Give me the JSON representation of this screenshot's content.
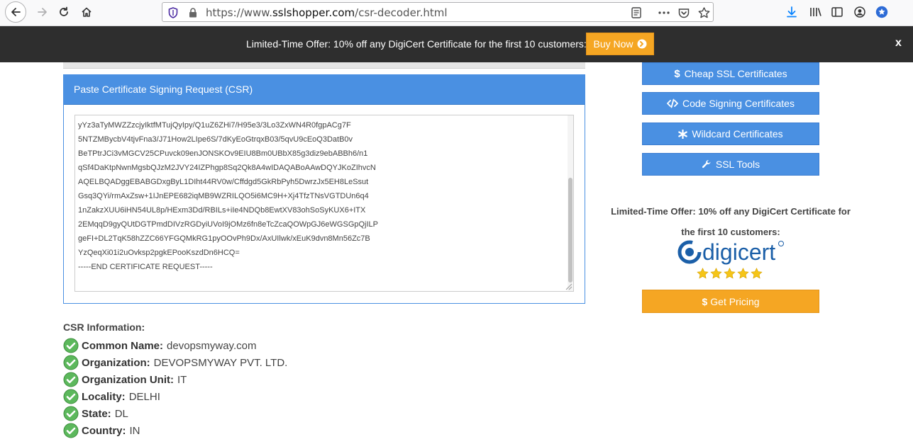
{
  "browser": {
    "url_prefix": "https://www.",
    "url_domain": "sslshopper.com",
    "url_path": "/csr-decoder.html"
  },
  "promo": {
    "text": "Limited-Time Offer: 10% off any DigiCert Certificate for the first 10 customers:",
    "button_label": "Buy Now",
    "close_label": "x"
  },
  "csr": {
    "panel_title": "Paste Certificate Signing Request (CSR)",
    "lines": [
      "yYz3aTyMWZZzcjyIktfMTujQyIpy/Q1uZ6ZHi7/H95e3/3Lo3ZxWN4R0fgpACg7F",
      "5NTZMBycbV4tjvFna3/J71How2LIpe6S/7dKyEoGtrqxB03/5qvU9cEoQ3DatB0v",
      "BeTPtrJCi3vMGCV25CPuvck09enJONSKOv9EIU8Bm0UBbX85g3diz9ebABBh6/n1",
      "qSf4DaKtpNwnMgsbQJzM2JVY24IZPhgp8Sq2Qk8A4wIDAQABoAAwDQYJKoZIhvcN",
      "AQELBQADggEBABGDxgByL1DIht44RV0w/Cffdgd5GkRbPyh5DwrzJx5EH8LeSsut",
      "Gsq3QYi/rmAxZsw+1IJnEPE682iqMB9WZRILQO5i6MC9H+Xj4TfzTNsVGTDUn6q4",
      "1nZakzXUU6iHN54UL8p/HExm3Dd/RBILs+iIe4NDQb8EwtXV83ohSoSyKUX6+ITX",
      "2EMqqD9gyQUtDGTPmdDIVzRGDyiUVoI9jOMz6fn8eTcZcaQOWpGJ6eWGSGpQjILP",
      "geFI+DL2TqK58hZZC66YFGQMkRG1pyOOvPh9Dx/AxUIlwk/xEuK9dvn8Mn56Zc7B",
      "YzQeqXi01i2uOvksp2pgkEPooKszdDn6HCQ=",
      "-----END CERTIFICATE REQUEST-----"
    ]
  },
  "csr_info": {
    "title": "CSR Information:",
    "rows": [
      {
        "key": "Common Name:",
        "value": "devopsmyway.com"
      },
      {
        "key": "Organization:",
        "value": "DEVOPSMYWAY PVT. LTD."
      },
      {
        "key": "Organization Unit:",
        "value": "IT"
      },
      {
        "key": "Locality:",
        "value": "DELHI"
      },
      {
        "key": "State:",
        "value": "DL"
      },
      {
        "key": "Country:",
        "value": "IN"
      }
    ]
  },
  "sidebar": {
    "buttons": [
      {
        "label": "Cheap SSL Certificates",
        "icon": "dollar-icon"
      },
      {
        "label": "Code Signing Certificates",
        "icon": "code-icon"
      },
      {
        "label": "Wildcard Certificates",
        "icon": "asterisk-icon"
      },
      {
        "label": "SSL Tools",
        "icon": "wrench-icon"
      }
    ],
    "offer_line1": "Limited-Time Offer: 10% off any DigiCert Certificate for",
    "offer_line2": "the first 10 customers:",
    "brand": "digicert",
    "rating_stars": 5,
    "pricing_label": "Get Pricing"
  },
  "colors": {
    "accent_blue": "#4a90e2",
    "accent_orange": "#f5a623",
    "banner_bg": "#2e2e2e",
    "check_green": "#5cb85c"
  }
}
